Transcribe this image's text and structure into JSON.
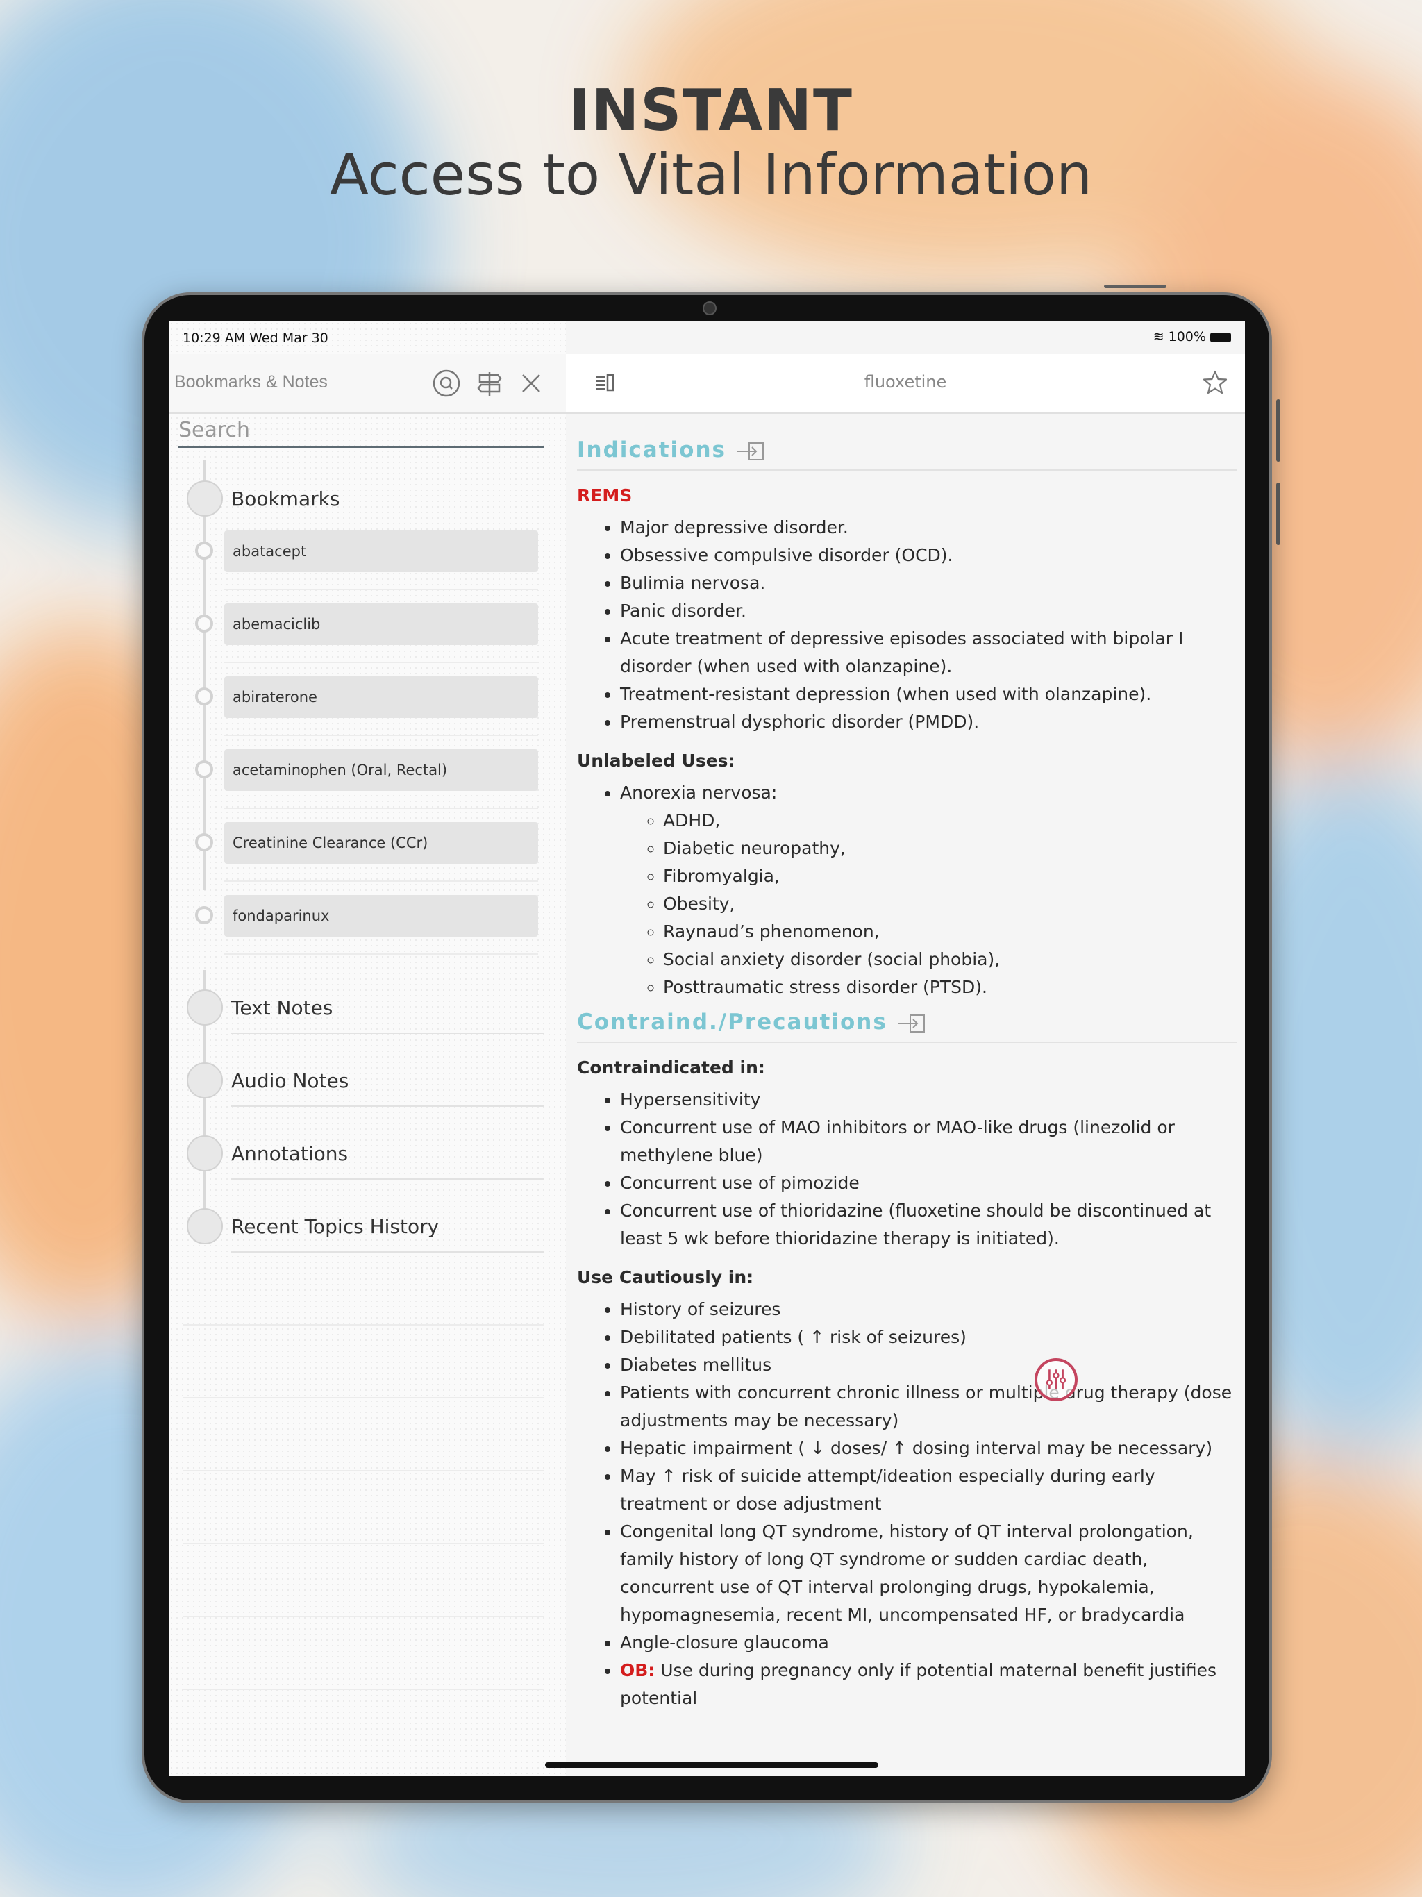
{
  "headline": {
    "line1": "INSTANT",
    "line2": "Access to Vital Information"
  },
  "status": {
    "time": "10:29 AM   Wed Mar 30",
    "battery": "100%"
  },
  "left_panel": {
    "title": "Bookmarks & Notes",
    "search_placeholder": "Search",
    "icons": [
      "search-icon",
      "signpost-icon",
      "close-icon"
    ],
    "bookmarks_label": "Bookmarks",
    "bookmarks": [
      "abatacept",
      "abemaciclib",
      "abiraterone",
      "acetaminophen (Oral, Rectal)",
      "Creatinine Clearance (CCr)",
      "fondaparinux"
    ],
    "sections": [
      "Text Notes",
      "Audio Notes",
      "Annotations",
      "Recent Topics History"
    ]
  },
  "right_panel": {
    "title": "fluoxetine",
    "icons": [
      "sidebar-toggle-icon",
      "star-icon"
    ],
    "indications": {
      "heading": "Indications",
      "rems": "REMS",
      "items": [
        "Major depressive disorder.",
        "Obsessive compulsive disorder (OCD).",
        "Bulimia nervosa.",
        "Panic disorder.",
        "Acute treatment of depressive episodes associated with bipolar I disorder (when used with olanzapine).",
        "Treatment-resistant depression (when used with olanzapine).",
        "Premenstrual dysphoric disorder (PMDD)."
      ],
      "unlabeled_heading": "Unlabeled Uses:",
      "unlabeled_main": "Anorexia nervosa:",
      "unlabeled_sub": [
        "ADHD,",
        "Diabetic neuropathy,",
        "Fibromyalgia,",
        "Obesity,",
        "Raynaud’s phenomenon,",
        "Social anxiety disorder (social phobia),",
        "Posttraumatic stress disorder (PTSD)."
      ]
    },
    "contraindications": {
      "heading": "Contraind./Precautions",
      "contra_heading": "Contraindicated in:",
      "contra_items": [
        "Hypersensitivity",
        "Concurrent use of MAO inhibitors or MAO-like drugs (linezolid or methylene blue)",
        "Concurrent use of pimozide",
        "Concurrent use of thioridazine (fluoxetine should be discontinued at least 5 wk before thioridazine therapy is initiated)."
      ],
      "caution_heading": "Use Cautiously in:",
      "caution_items": [
        "History of seizures",
        "Debilitated patients ( ↑  risk of seizures)",
        "Diabetes mellitus",
        "Patients with concurrent chronic illness or multiple drug therapy (dose adjustments may be necessary)",
        "Hepatic impairment ( ↓  doses/ ↑  dosing interval may be necessary)",
        "May  ↑  risk of suicide attempt/ideation especially during early treatment or dose adjustment",
        "Congenital long QT syndrome, history of QT interval prolongation, family history of long QT syndrome or sudden cardiac death, concurrent use of QT interval prolonging drugs, hypokalemia, hypomagnesemia, recent MI, uncompensated HF, or bradycardia",
        "Angle-closure glaucoma"
      ],
      "ob_label": "OB:",
      "ob_text": " Use during pregnancy only if potential maternal benefit justifies potential"
    },
    "fab_icon": "settings-sliders-icon"
  },
  "colors": {
    "accent": "#7cc6d2",
    "alert": "#d41d1d",
    "fab": "#c4455f"
  }
}
